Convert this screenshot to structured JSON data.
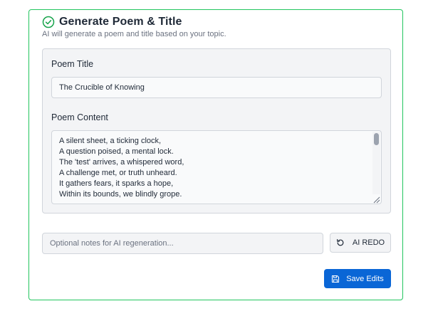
{
  "header": {
    "title": "Generate Poem & Title",
    "subtitle": "AI will generate a poem and title based on your topic."
  },
  "poem_form": {
    "title_label": "Poem Title",
    "title_value": "The Crucible of Knowing",
    "content_label": "Poem Content",
    "content_lines": [
      "A silent sheet, a ticking clock,",
      "A question poised, a mental lock.",
      "The 'test' arrives, a whispered word,",
      "A challenge met, or truth unheard.",
      "It gathers fears, it sparks a hope,",
      "Within its bounds, we blindly grope."
    ]
  },
  "regeneration": {
    "notes_placeholder": "Optional notes for AI regeneration...",
    "notes_value": "",
    "redo_label": "AI REDO"
  },
  "actions": {
    "save_label": "Save Edits"
  },
  "colors": {
    "card_border": "#22c55e",
    "accent_check": "#16a34a",
    "primary_button": "#0a66d6"
  },
  "icons": {
    "header": "check-circle-icon",
    "redo": "rotate-ccw-icon",
    "save": "save-icon"
  }
}
